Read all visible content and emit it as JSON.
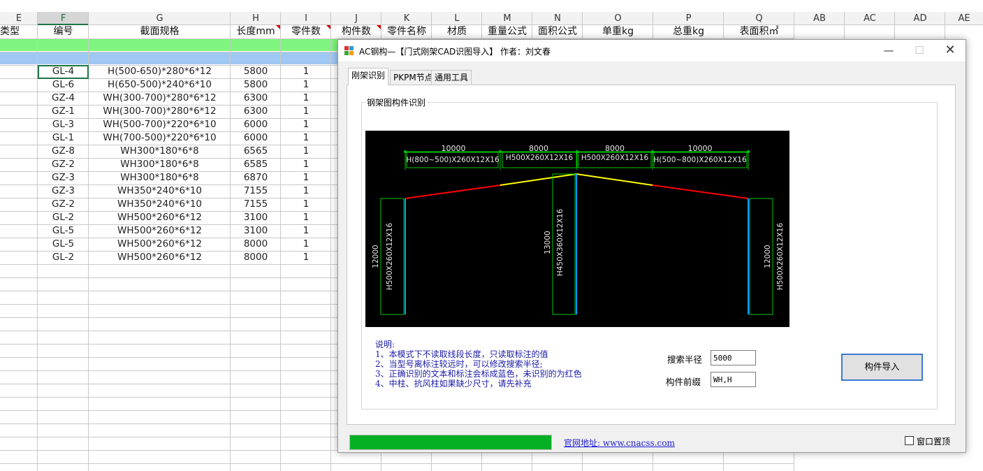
{
  "sheet": {
    "col_letters": [
      "E",
      "F",
      "G",
      "H",
      "I",
      "J",
      "K",
      "L",
      "M",
      "N",
      "O",
      "P",
      "Q",
      "AB",
      "AC",
      "AD",
      "AE"
    ],
    "headers": [
      "面类型",
      "编号",
      "截面规格",
      "长度mm",
      "零件数",
      "构件数",
      "零件名称",
      "材质",
      "重量公式",
      "面积公式",
      "单重kg",
      "总重kg",
      "表面积㎡"
    ],
    "rows": [
      {
        "id": "GL-4",
        "spec": "H(500-650)*280*6*12",
        "len": "5800",
        "qty": "1"
      },
      {
        "id": "GL-6",
        "spec": "H(650-500)*240*6*10",
        "len": "5800",
        "qty": "1"
      },
      {
        "id": "GZ-4",
        "spec": "WH(300-700)*280*6*12",
        "len": "6300",
        "qty": "1"
      },
      {
        "id": "GZ-1",
        "spec": "WH(300-700)*280*6*12",
        "len": "6300",
        "qty": "1"
      },
      {
        "id": "GL-3",
        "spec": "WH(500-700)*220*6*10",
        "len": "6000",
        "qty": "1"
      },
      {
        "id": "GL-1",
        "spec": "WH(700-500)*220*6*10",
        "len": "6000",
        "qty": "1"
      },
      {
        "id": "GZ-8",
        "spec": "WH300*180*6*8",
        "len": "6565",
        "qty": "1"
      },
      {
        "id": "GZ-2",
        "spec": "WH300*180*6*8",
        "len": "6585",
        "qty": "1"
      },
      {
        "id": "GZ-3",
        "spec": "WH300*180*6*8",
        "len": "6870",
        "qty": "1"
      },
      {
        "id": "GZ-3",
        "spec": "WH350*240*6*10",
        "len": "7155",
        "qty": "1"
      },
      {
        "id": "GZ-2",
        "spec": "WH350*240*6*10",
        "len": "7155",
        "qty": "1"
      },
      {
        "id": "GL-2",
        "spec": "WH500*260*6*12",
        "len": "3100",
        "qty": "1"
      },
      {
        "id": "GL-5",
        "spec": "WH500*260*6*12",
        "len": "3100",
        "qty": "1"
      },
      {
        "id": "GL-5",
        "spec": "WH500*260*6*12",
        "len": "8000",
        "qty": "1"
      },
      {
        "id": "GL-2",
        "spec": "WH500*260*6*12",
        "len": "8000",
        "qty": "1"
      }
    ],
    "colors": {
      "green_band": "#7ff57f",
      "blue_band": "#9fc9f3",
      "accent": "#217346"
    }
  },
  "dialog": {
    "title": "AC钢构—【门式刚架CAD识图导入】 作者：刘文春",
    "tabs": [
      "刚架识别",
      "PKPM节点",
      "通用工具"
    ],
    "group_label": "钢架图构件识别",
    "cad": {
      "spans": [
        "10000",
        "8000",
        "8000",
        "10000"
      ],
      "beam_labels": [
        "H(800~500)X260X12X16",
        "H500X260X12X16",
        "H500X260X12X16",
        "H(500~800)X260X12X16"
      ],
      "left_col_height": "12000",
      "left_col_section": "H500X260X12X16",
      "mid_col_height": "13000",
      "mid_col_section": "H450X360X12X16",
      "right_col_height": "12000",
      "right_col_section": "H500X260X12X16",
      "colors": {
        "bg": "#000000",
        "dim": "#00c800",
        "red": "#ff0000",
        "yellow": "#ffff00",
        "blue": "#00a0ff",
        "text": "#e8e8e8"
      }
    },
    "notes": [
      "说明:",
      "1、本模式下不读取线段长度，只读取标注的值",
      "2、当型号离标注较远时，可以修改搜索半径;",
      "3、正确识别的文本和标注会标成蓝色，未识别的为红色",
      "4、中柱、抗风柱如果缺少尺寸，请先补充"
    ],
    "search_radius_label": "搜索半径",
    "search_radius_value": "5000",
    "prefix_label": "构件前缀",
    "prefix_value": "WH,H",
    "import_button": "构件导入",
    "progress": 1.0,
    "site_link": "官网地址: www.cnacss.com",
    "topmost_label": "窗口置顶",
    "topmost_checked": false
  }
}
